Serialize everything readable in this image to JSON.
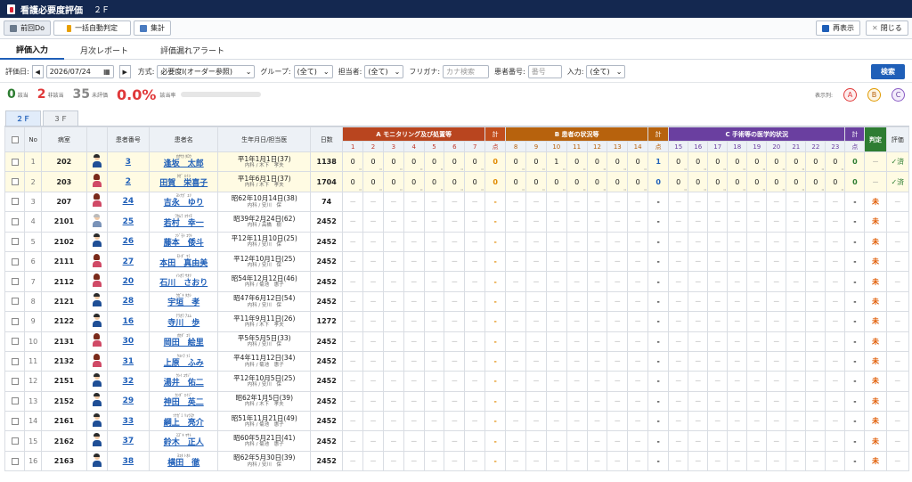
{
  "app": {
    "title": "看護必要度評価",
    "ward": "２Ｆ"
  },
  "toolbar": {
    "prev_do": "前回Do",
    "auto_judge": "一括自動判定",
    "aggregate": "集計",
    "redisplay": "再表示",
    "close": "閉じる"
  },
  "tabs": [
    "評価入力",
    "月次レポート",
    "評価漏れアラート"
  ],
  "filter": {
    "date_label": "評価日:",
    "date_value": "2026/07/24",
    "method_label": "方式:",
    "method_value": "必要度Ⅰ(オーダー参照)",
    "group_label": "グループ:",
    "group_value": "(全て)",
    "nurse_label": "担当者:",
    "nurse_value": "(全て)",
    "kana_label": "フリガナ:",
    "kana_placeholder": "カナ検索",
    "pid_label": "患者番号:",
    "pid_placeholder": "番号",
    "input_label": "入力:",
    "input_value": "(全て)",
    "search": "検索"
  },
  "summary": {
    "applicable": "0",
    "applicable_label": "該当",
    "not_applicable": "2",
    "not_applicable_label": "非該当",
    "unevaluated": "35",
    "unevaluated_label": "未評価",
    "rate": "0.0%",
    "rate_label": "該当率",
    "display_label": "表示列:",
    "display_options": [
      "A",
      "B",
      "C"
    ]
  },
  "colors": {
    "header": "#142850",
    "A": "#b9451f",
    "B": "#b7620d",
    "C": "#6a3fa0",
    "judge": "#2e7d32",
    "accent": "#1f5fb8"
  },
  "ward_tabs": [
    "２Ｆ",
    "３Ｆ"
  ],
  "table": {
    "headers": {
      "no": "No",
      "room": "病室",
      "pid": "患者番号",
      "name": "患者名",
      "birth": "生年月日/担当医",
      "days": "日数",
      "groupA": "A モニタリング及び処置等",
      "groupB": "B 患者の状況等",
      "groupC": "C 手術等の医学的状況",
      "total": "計",
      "judge": "判定",
      "eval": "評価",
      "subtotal": "点"
    },
    "colsA": [
      "1",
      "2",
      "3",
      "4",
      "5",
      "6",
      "7"
    ],
    "colsB": [
      "8",
      "9",
      "10",
      "11",
      "12",
      "13",
      "14"
    ],
    "colsC": [
      "15",
      "16",
      "17",
      "18",
      "19",
      "20",
      "21",
      "22",
      "23"
    ],
    "rows": [
      {
        "no": "1",
        "room": "202",
        "pid": "3",
        "kana": "ｵｵｻｶ ﾀﾛｳ",
        "name": "逢坂　太郎",
        "birth": "平1年1月1日(37)",
        "doc": "内科 / 木下　孝夫",
        "days": "1138",
        "a": [
          "0",
          "0",
          "0",
          "0",
          "0",
          "0",
          "0"
        ],
        "at": "0",
        "b": [
          "0",
          "0",
          "1",
          "0",
          "0",
          "0",
          "0"
        ],
        "bt": "1",
        "c": [
          "0",
          "0",
          "0",
          "0",
          "0",
          "0",
          "0",
          "0",
          "0"
        ],
        "ct": "0",
        "judge": "－",
        "eval": "✓済",
        "g": "m",
        "done": true
      },
      {
        "no": "2",
        "room": "203",
        "pid": "2",
        "kana": "ﾀｶﾞ ｴｲｺ",
        "name": "田賀　栄喜子",
        "birth": "平1年6月1日(37)",
        "doc": "内科 / 木下　孝夫",
        "days": "1704",
        "a": [
          "0",
          "0",
          "0",
          "0",
          "0",
          "0",
          "0"
        ],
        "at": "0",
        "b": [
          "0",
          "0",
          "0",
          "0",
          "0",
          "0",
          "0"
        ],
        "bt": "0",
        "c": [
          "0",
          "0",
          "0",
          "0",
          "0",
          "0",
          "0",
          "0",
          "0"
        ],
        "ct": "0",
        "judge": "－",
        "eval": "✓済",
        "g": "f",
        "done": true
      },
      {
        "no": "3",
        "room": "207",
        "pid": "24",
        "kana": "ﾖｼﾅｶﾞ ﾕﾘ",
        "name": "吉永　ゆり",
        "birth": "昭62年10月14日(38)",
        "doc": "内科 / 安川　保",
        "days": "74",
        "judge": "未",
        "eval": "－",
        "g": "f"
      },
      {
        "no": "4",
        "room": "2101",
        "pid": "25",
        "kana": "ﾜｶﾑﾗ ｺｳｲﾁ",
        "name": "若村　幸一",
        "birth": "昭39年2月24日(62)",
        "doc": "内科 / 高橋　樹",
        "days": "2452",
        "judge": "未",
        "eval": "－",
        "g": "o"
      },
      {
        "no": "5",
        "room": "2102",
        "pid": "26",
        "kana": "ﾌｼﾞﾓﾄ ｺｳﾄ",
        "name": "藤本　倭斗",
        "birth": "平12年11月10日(25)",
        "doc": "内科 / 安川　保",
        "days": "2452",
        "judge": "未",
        "eval": "－",
        "g": "m"
      },
      {
        "no": "6",
        "room": "2111",
        "pid": "27",
        "kana": "ﾓﾄﾀﾞ ﾏﾐ",
        "name": "本田　真由美",
        "birth": "平12年10月1日(25)",
        "doc": "内科 / 安川　保",
        "days": "2452",
        "judge": "未",
        "eval": "－",
        "g": "f"
      },
      {
        "no": "7",
        "room": "2112",
        "pid": "20",
        "kana": "ｲｼｶﾜ ｻｵﾘ",
        "name": "石川　さおり",
        "birth": "昭54年12月12日(46)",
        "doc": "内科 / 菊池　惠子",
        "days": "2452",
        "judge": "未",
        "eval": "－",
        "g": "f"
      },
      {
        "no": "8",
        "room": "2121",
        "pid": "28",
        "kana": "ｳｶﾞｷ ﾀｶｼ",
        "name": "宇垣　孝",
        "birth": "昭47年6月12日(54)",
        "doc": "内科 / 安川　保",
        "days": "2452",
        "judge": "未",
        "eval": "－",
        "g": "m"
      },
      {
        "no": "9",
        "room": "2122",
        "pid": "16",
        "kana": "ﾃﾗｶﾜ ｱﾕﾑ",
        "name": "寺川　歩",
        "birth": "平11年9月11日(26)",
        "doc": "内科 / 木下　孝夫",
        "days": "1272",
        "judge": "未",
        "eval": "－",
        "g": "m"
      },
      {
        "no": "10",
        "room": "2131",
        "pid": "30",
        "kana": "ｵｶﾀﾞ ｴﾘ",
        "name": "岡田　絵里",
        "birth": "平5年5月5日(33)",
        "doc": "内科 / 安川　保",
        "days": "2452",
        "judge": "未",
        "eval": "－",
        "g": "f"
      },
      {
        "no": "11",
        "room": "2132",
        "pid": "31",
        "kana": "ｳｴﾊﾗ ﾌﾐ",
        "name": "上原　ふみ",
        "birth": "平4年11月12日(34)",
        "doc": "内科 / 菊池　惠子",
        "days": "2452",
        "judge": "未",
        "eval": "－",
        "g": "f"
      },
      {
        "no": "12",
        "room": "2151",
        "pid": "32",
        "kana": "ｳｼｲ ﾕｳｼﾞ",
        "name": "湯井　佑二",
        "birth": "平12年10月5日(25)",
        "doc": "内科 / 安川　保",
        "days": "2452",
        "judge": "未",
        "eval": "－",
        "g": "m"
      },
      {
        "no": "13",
        "room": "2152",
        "pid": "29",
        "kana": "ｶﾝﾀﾞ ｴｲｼﾞ",
        "name": "神田　英二",
        "birth": "昭62年1月5日(39)",
        "doc": "内科 / 木下　孝夫",
        "days": "2452",
        "judge": "未",
        "eval": "－",
        "g": "m"
      },
      {
        "no": "14",
        "room": "2161",
        "pid": "33",
        "kana": "ﾂﾅｶﾞﾐ ﾘｮｳｽｹ",
        "name": "綱上　亮介",
        "birth": "昭51年11月21日(49)",
        "doc": "内科 / 菊池　惠子",
        "days": "2452",
        "judge": "未",
        "eval": "－",
        "g": "m"
      },
      {
        "no": "15",
        "room": "2162",
        "pid": "37",
        "kana": "ｽｽﾞｷ ﾏｻﾄ",
        "name": "鈴木　正人",
        "birth": "昭60年5月21日(41)",
        "doc": "内科 / 菊池　惠子",
        "days": "2452",
        "judge": "未",
        "eval": "－",
        "g": "m"
      },
      {
        "no": "16",
        "room": "2163",
        "pid": "38",
        "kana": "ﾖｺﾀ ﾄｵﾙ",
        "name": "横田　徹",
        "birth": "昭62年5月30日(39)",
        "doc": "内科 / 安川　保",
        "days": "2452",
        "judge": "未",
        "eval": "－",
        "g": "m"
      }
    ]
  }
}
